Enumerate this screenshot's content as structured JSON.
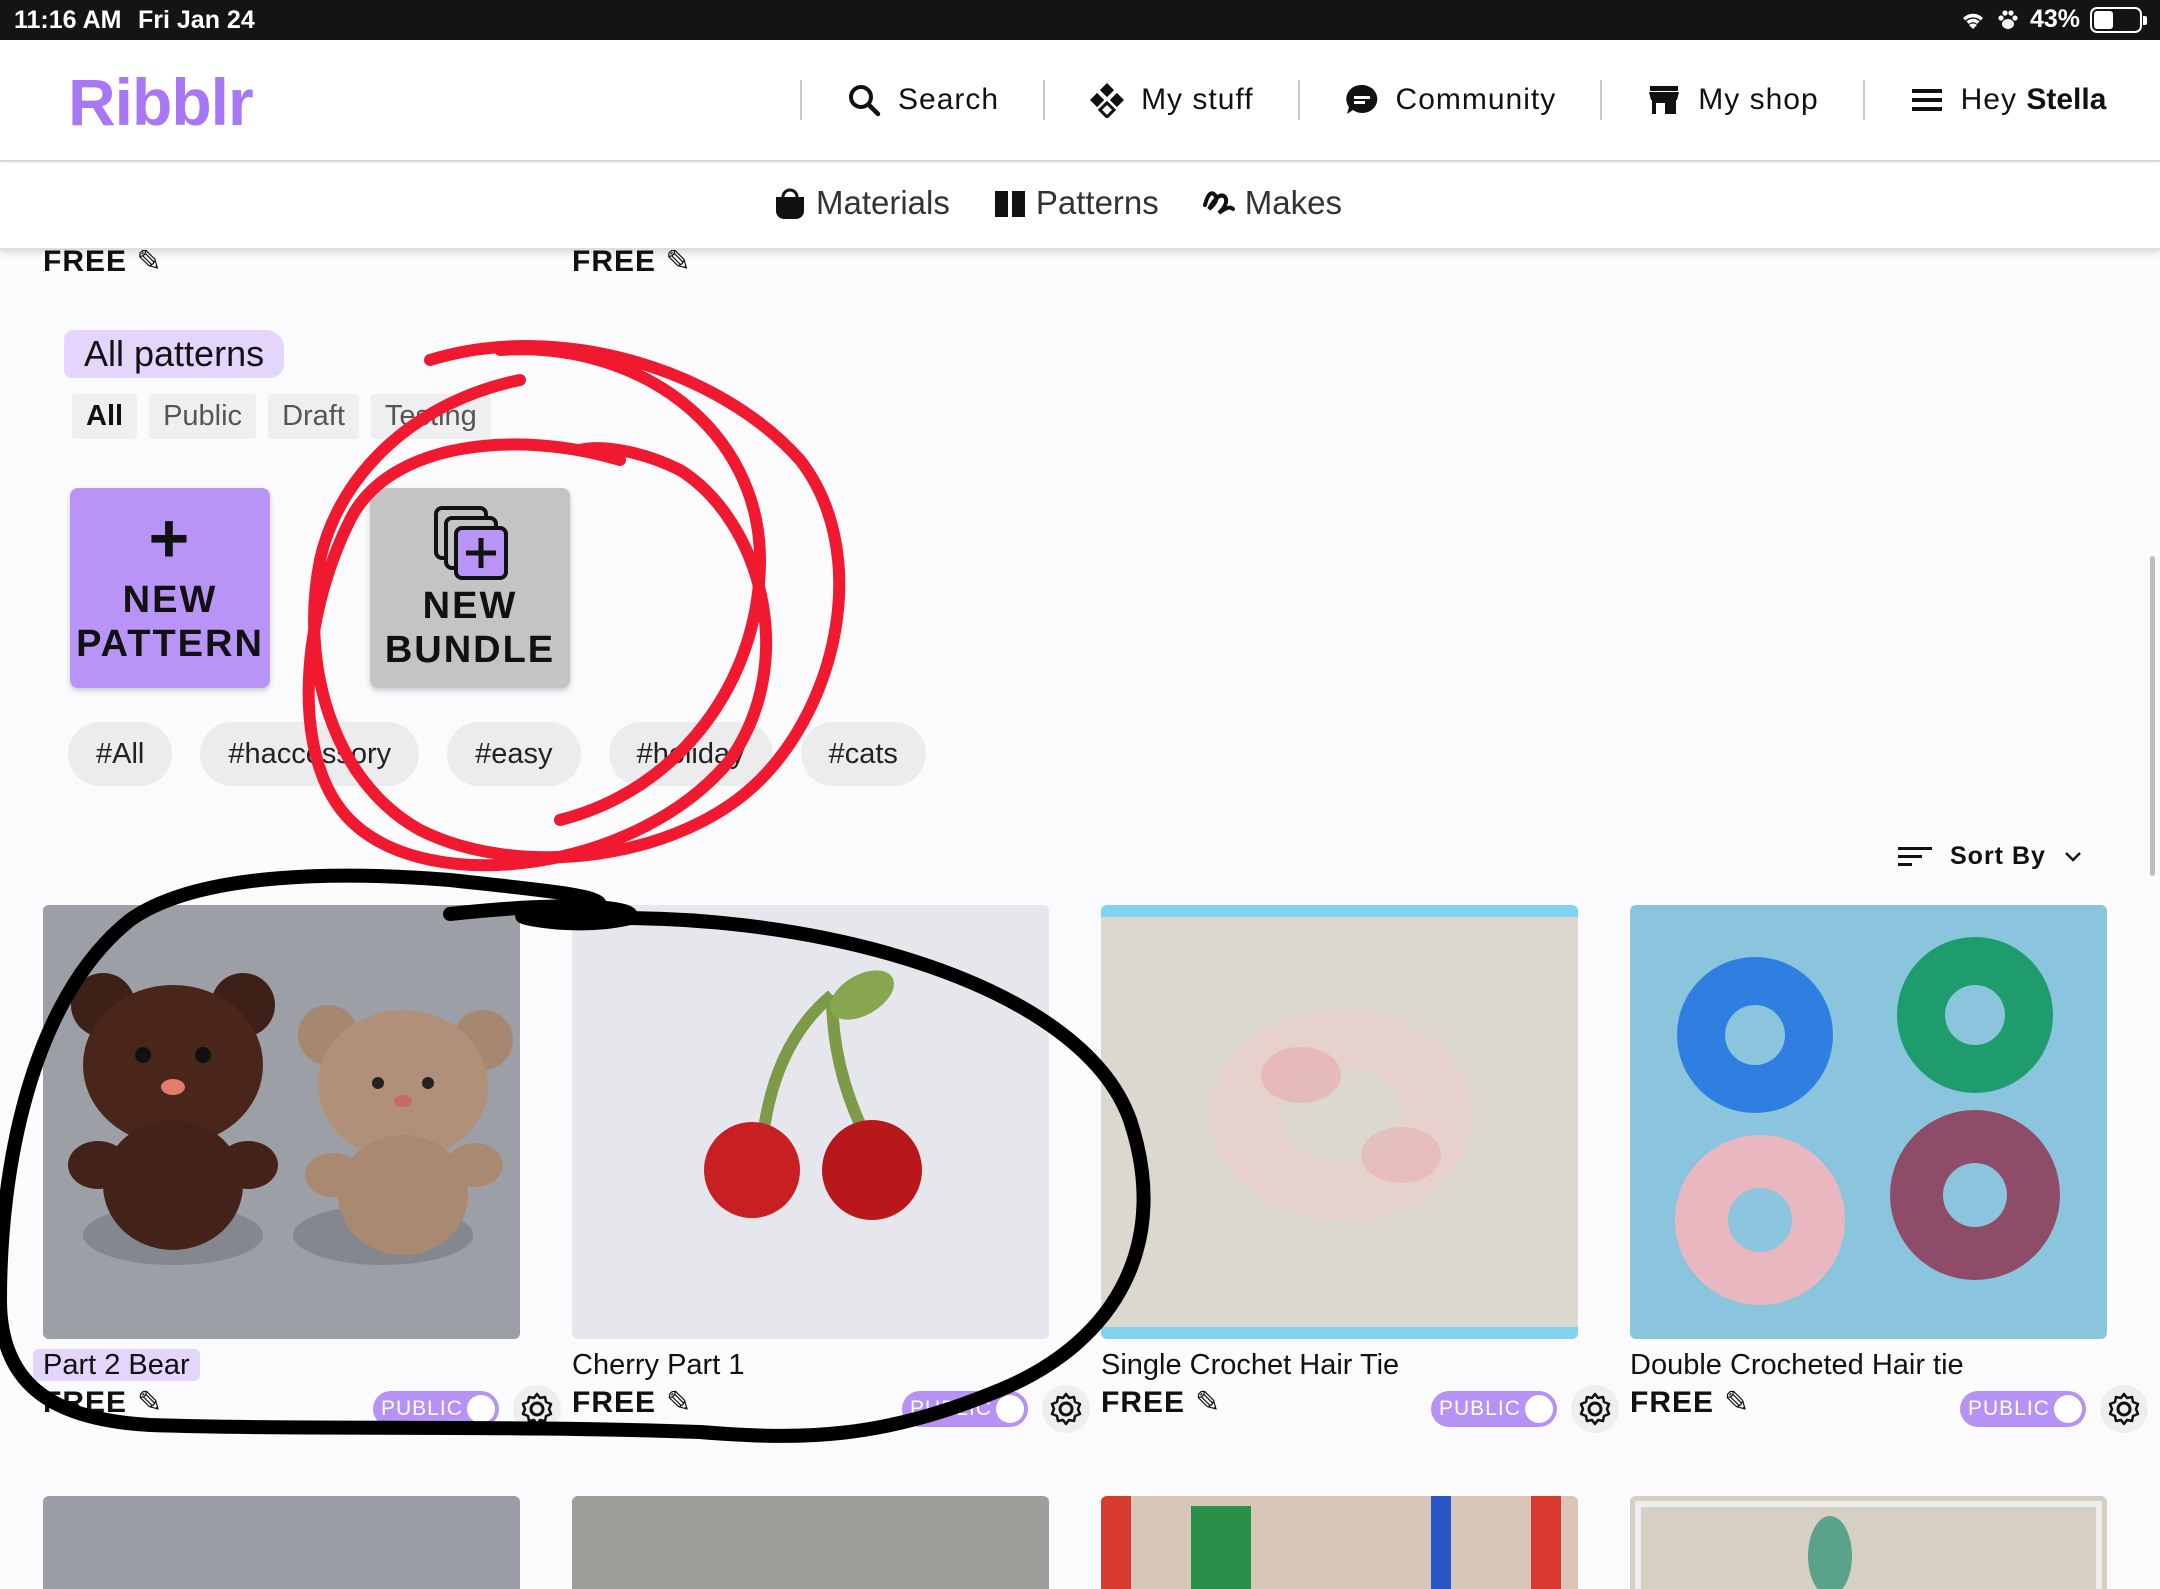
{
  "status_bar": {
    "time": "11:16 AM",
    "date": "Fri Jan 24",
    "battery": "43%",
    "battery_level": 0.43
  },
  "header": {
    "logo": "Ribblr",
    "nav": [
      {
        "label": "Search",
        "icon": "search-icon"
      },
      {
        "label": "My stuff",
        "icon": "diamond-grid-icon"
      },
      {
        "label": "Community",
        "icon": "chat-bubble-icon"
      },
      {
        "label": "My shop",
        "icon": "shop-icon"
      }
    ],
    "menu": {
      "greeting": "Hey",
      "name": "Stella",
      "icon": "hamburger-icon"
    }
  },
  "subnav": {
    "tabs": [
      {
        "label": "Materials",
        "icon": "bag-icon"
      },
      {
        "label": "Patterns",
        "icon": "book-icon"
      },
      {
        "label": "Makes",
        "icon": "yarn-icon"
      }
    ]
  },
  "top_prices": [
    "FREE",
    "FREE"
  ],
  "filters": {
    "title": "All patterns",
    "status_pills": [
      "All",
      "Public",
      "Draft",
      "Testing"
    ],
    "active_pill": "All"
  },
  "actions": {
    "new_pattern": {
      "line1": "NEW",
      "line2": "PATTERN"
    },
    "new_bundle": {
      "line1": "NEW",
      "line2": "BUNDLE"
    }
  },
  "tags": [
    "#All",
    "#haccessory",
    "#easy",
    "#holiday",
    "#cats"
  ],
  "sort": {
    "label": "Sort By"
  },
  "cards": [
    {
      "title": "Part 2 Bear",
      "price": "FREE",
      "status": "PUBLIC"
    },
    {
      "title": "Cherry Part 1",
      "price": "FREE",
      "status": "PUBLIC"
    },
    {
      "title": "Single Crochet Hair Tie",
      "price": "FREE",
      "status": "PUBLIC"
    },
    {
      "title": "Double Crocheted Hair tie",
      "price": "FREE",
      "status": "PUBLIC"
    }
  ],
  "colors": {
    "brand": "#a877f5",
    "toggle": "#b592f3",
    "new_pattern_bg": "#b894f7",
    "new_bundle_bg": "#c4c4c4",
    "annotation_red": "#f0192f",
    "annotation_black": "#000000"
  }
}
